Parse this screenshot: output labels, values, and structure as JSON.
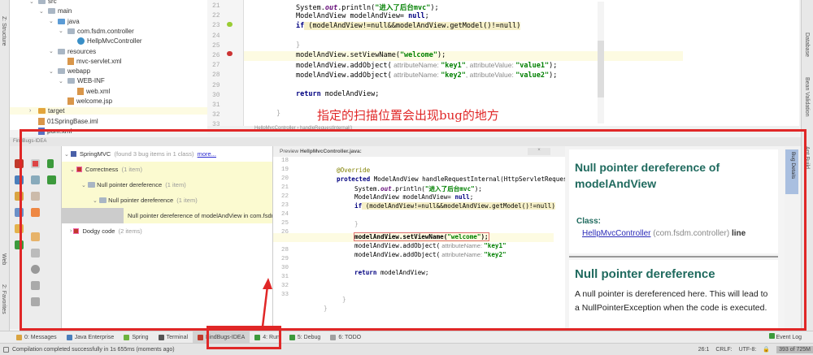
{
  "side_tabs": {
    "structure": "Z: Structure",
    "web": "Web",
    "favorites": "2: Favorites",
    "database": "Database",
    "bean_validation": "Bean Validation",
    "ant_build": "Ant Build",
    "bug_details": "Bug Details"
  },
  "project_tree": [
    {
      "label": "src",
      "indent": 1,
      "icon": "folder"
    },
    {
      "label": "main",
      "indent": 2,
      "icon": "folder"
    },
    {
      "label": "java",
      "indent": 3,
      "icon": "folder"
    },
    {
      "label": "com.fsdm.controller",
      "indent": 4,
      "icon": "package"
    },
    {
      "label": "HellpMvcController",
      "indent": 5,
      "icon": "class"
    },
    {
      "label": "resources",
      "indent": 3,
      "icon": "folder"
    },
    {
      "label": "mvc-servlet.xml",
      "indent": 4,
      "icon": "xml"
    },
    {
      "label": "webapp",
      "indent": 3,
      "icon": "folder"
    },
    {
      "label": "WEB-INF",
      "indent": 4,
      "icon": "folder"
    },
    {
      "label": "web.xml",
      "indent": 5,
      "icon": "xml"
    },
    {
      "label": "welcome.jsp",
      "indent": 4,
      "icon": "jsp"
    },
    {
      "label": "target",
      "indent": 1,
      "icon": "folder-orange"
    },
    {
      "label": "01SpringBase.iml",
      "indent": 1,
      "icon": "iml"
    },
    {
      "label": "pom.xml",
      "indent": 1,
      "icon": "maven"
    }
  ],
  "editor": {
    "line_numbers": [
      "21",
      "22",
      "23",
      "24",
      "25",
      "26",
      "27",
      "28",
      "29",
      "30",
      "31",
      "32",
      "33"
    ],
    "println_pre": "System.",
    "println_out": "out",
    "println_mid": ".println(",
    "println_str": "\"进入了后台mvc\"",
    "println_end": ");",
    "decl_pre": "ModelAndView modelAndView= ",
    "null_kw": "null",
    "semi": ";",
    "if_kw": "if",
    "if_cond": " (modelAndView!=null&&modelAndView.getModel()!=null)",
    "brace": "}",
    "setview_pre": "modelAndView.setViewName(",
    "welcome_str": "\"welcome\"",
    "close": ");",
    "addobj": "modelAndView.addObject(",
    "attr_name": " attributeName: ",
    "key1": "\"key1\"",
    "attr_value": ", attributeValue: ",
    "value1": "\"value1\"",
    "key2": "\"key2\"",
    "value2": "\"value2\"",
    "return_kw": "return",
    "return_rest": " modelAndView;"
  },
  "annotation_text": "指定的扫描位置会出现bug的地方",
  "breadcrumb": "HellpMvcController  ›  handleRequestInternal()",
  "findbugs": {
    "title": "FindBugs-IDEA",
    "tree": [
      {
        "label": "SpringMVC",
        "count": "(found 3 bug items in 1 class)",
        "link": "more..."
      },
      {
        "label": "Correctness",
        "count": "(1 item)"
      },
      {
        "label": "Null pointer dereference",
        "count": "(1 item)"
      },
      {
        "label": "Null pointer dereference",
        "count": "(1 item)"
      },
      {
        "label": "Null pointer dereference of modelAndView in com.fsdm.controller",
        "count": ""
      },
      {
        "label": "Dodgy code",
        "count": "(2 items)"
      }
    ],
    "preview_label": "Preview",
    "preview_file": "HellpMvcController.java:",
    "preview_lines": [
      "18",
      "19",
      "20",
      "21",
      "22",
      "23",
      "24",
      "25",
      "26",
      "27",
      "28",
      "29",
      "30",
      "31",
      "32",
      "33"
    ],
    "override": "@Override",
    "protected_kw": "protected",
    "handle_sig": " ModelAndView handleRequestInternal(HttpServletRequest",
    "details": {
      "title": "Null pointer dereference of modelAndView",
      "class_label": "Class:",
      "class_link": "HellpMvcController",
      "class_pkg": "(com.fsdm.controller)",
      "class_line": "line",
      "pattern_title": "Null pointer dereference",
      "description": "A null pointer is dereferenced here.  This will lead to a NullPointerException when the code is executed."
    }
  },
  "tool_windows": [
    {
      "label": "0: Messages",
      "color": "#d9a441"
    },
    {
      "label": "Java Enterprise",
      "color": "#4a7ebb"
    },
    {
      "label": "Spring",
      "color": "#6db33f"
    },
    {
      "label": "Terminal",
      "color": "#555555"
    },
    {
      "label": "FindBugs-IDEA",
      "color": "#c0392b",
      "active": true
    },
    {
      "label": "4: Run",
      "color": "#3c9a3c"
    },
    {
      "label": "5: Debug",
      "color": "#3c9a3c"
    },
    {
      "label": "6: TODO",
      "color": "#a0a0a0"
    }
  ],
  "event_log": "Event Log",
  "status": {
    "message": "Compilation completed successfully in 1s 655ms (moments ago)",
    "position": "26:1",
    "line_sep": "CRLF:",
    "encoding": "UTF-8:",
    "memory": "393 of 725M"
  },
  "accent": "#e02727"
}
